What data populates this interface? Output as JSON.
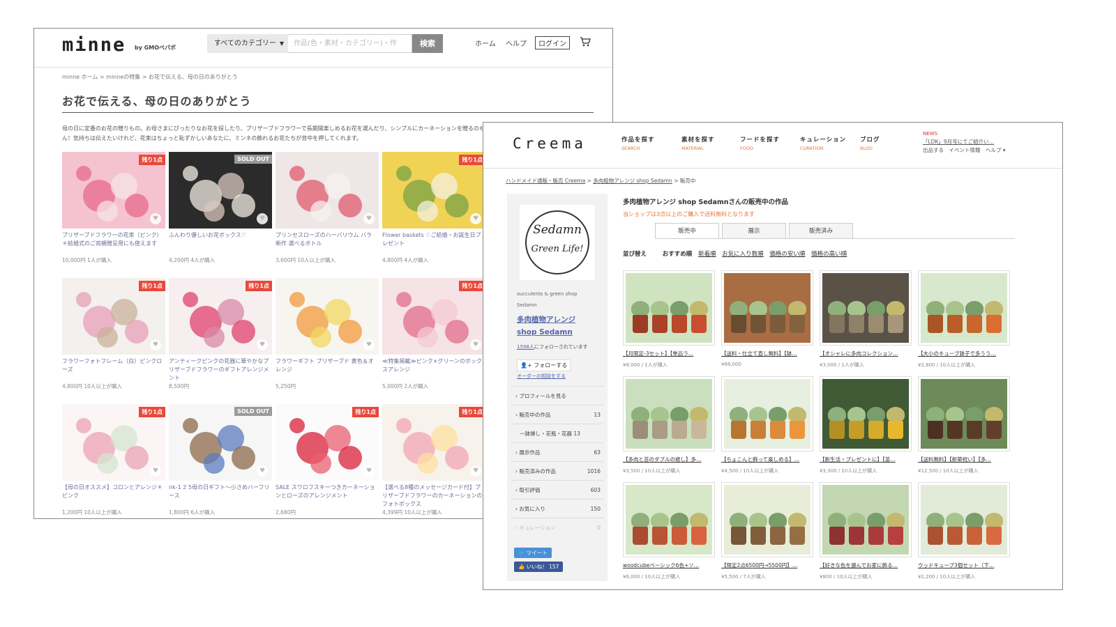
{
  "minne": {
    "logo": "minne",
    "logo_sub": "by GMOペパボ",
    "category_select": "すべてのカテゴリー",
    "search_placeholder": "作品(色・素材・カテゴリー)・作",
    "search_button": "検索",
    "nav_home": "ホーム",
    "nav_help": "ヘルプ",
    "nav_login": "ログイン",
    "breadcrumb": "minne ホーム  >  minneの特集  >  お花で伝える、母の日のありがとう",
    "page_title": "お花で伝える、母の日のありがとう",
    "description": "母の日に定番のお花の贈りもの。お母さまにぴったりなお花を探したり、プリザーブドフラワーで長期間楽しめるお花を選んだり、シンプルにカーネーションを贈るのも素敵ね。今年も人気のハーバリウムもたくさん！気持ちは伝えたいけれど、花束はちょっと恥ずかしいあなたに、ミンネの飾れるお花たちが背中を押してくれます。",
    "products": [
      {
        "badge": "残り1点",
        "name": "プリザーブドフラワーの花束（ピンク）＊結婚式のご両親贈呈用にも使えます",
        "price": "10,000円  1人が購入",
        "colors": [
          "#f4c3cf",
          "#e86a8c",
          "#f7e3e8"
        ]
      },
      {
        "badge": "SOLD OUT",
        "name": "ふんわり優しいお花ボックス♡",
        "price": "4,200円  4人が購入",
        "colors": [
          "#2b2b2b",
          "#f3ece4",
          "#d9c7c0"
        ]
      },
      {
        "badge": "",
        "name": "プリンセスローズのハーバリウム  バラ 新作  選べるボトル",
        "price": "3,600円  10人以上が購入",
        "colors": [
          "#efe6e6",
          "#e05a6e",
          "#f7f0f0"
        ]
      },
      {
        "badge": "残り1点",
        "name": "Flower baskets ♡ご結婚・お誕生日プレゼント",
        "price": "4,800円  4人が購入",
        "colors": [
          "#f0d255",
          "#7aa245",
          "#f5f0e0"
        ]
      },
      {
        "badge": "残り1点",
        "name": "フラワーフォトフレーム（白）ピンクローズ",
        "price": "4,800円  10人以上が購入",
        "colors": [
          "#f3f0ee",
          "#e7a0b8",
          "#c9b29a"
        ]
      },
      {
        "badge": "残り1点",
        "name": "アンティークピンクの花器に華やかなプリザーブドフラワーのギフトアレンジメント",
        "price": "8,500円",
        "colors": [
          "#f7eef0",
          "#e0426e",
          "#d88aa8"
        ]
      },
      {
        "badge": "",
        "name": "フラワーギフト  プリザーブド  黄色＆オレンジ",
        "price": "5,250円",
        "colors": [
          "#f7f5f0",
          "#f19a3e",
          "#f3d860"
        ]
      },
      {
        "badge": "残り1点",
        "name": "≪特集掲載≫ピンク×グリーンのボックスアレンジ",
        "price": "5,000円  2人が購入",
        "colors": [
          "#f5e3e6",
          "#e26d8c",
          "#f6c9d3"
        ]
      },
      {
        "badge": "残り1点",
        "name": "【母の日オススメ】コロンとアレンジ＊ピンク",
        "price": "1,200円  10人以上が購入",
        "colors": [
          "#fcf5f5",
          "#eba3b3",
          "#d6e4d0"
        ]
      },
      {
        "badge": "SOLD OUT",
        "name": "nk-1 2 5母の日ギフト〜小さめハーフリース",
        "price": "1,800円  6人が購入",
        "colors": [
          "#f6f6f6",
          "#8c6a4a",
          "#5b7bbd"
        ]
      },
      {
        "badge": "残り1点",
        "name": "SALE スワロフスキーつきカーネーションとローズのアレンジメント",
        "price": "2,680円",
        "colors": [
          "#fbfbfb",
          "#d9203a",
          "#e86070"
        ]
      },
      {
        "badge": "残り1点",
        "name": "【選べる8種のメッセージカード付】プリザーブドフラワーのカーネーションのフォトボックス",
        "price": "4,399円  10人以上が購入",
        "colors": [
          "#f7f2ec",
          "#f2a5b5",
          "#ffe0a0"
        ]
      }
    ]
  },
  "creema": {
    "logo": "Creema",
    "nav": [
      {
        "jp": "作品を探す",
        "en": "SEARCH"
      },
      {
        "jp": "素材を探す",
        "en": "MATERIAL"
      },
      {
        "jp": "フードを探す",
        "en": "FOOD"
      },
      {
        "jp": "キュレーション",
        "en": "CURATION"
      },
      {
        "jp": "ブログ",
        "en": "BLOG"
      }
    ],
    "news_label": "NEWS",
    "news_text": "「LDK」9月号にてご紹介い…",
    "news_links": "出品する　イベント情報　ヘルプ ▾",
    "breadcrumb_1": "ハンドメイド通販・販売 Creema",
    "breadcrumb_2": "多肉植物アレンジ shop Sedamn",
    "breadcrumb_3": "販売中",
    "shop_logo_1": "Sedamn",
    "shop_logo_2": "Green Life!",
    "shop_sub_1": "succulents & green shop",
    "shop_sub_2": "Sedamn",
    "shop_name_1": "多肉植物アレンジ",
    "shop_name_2": "shop Sedamn",
    "follow_count_num": "1598人",
    "follow_count_text": "にフォローされています",
    "follow_button": "フォローする",
    "order_link": "オーダーの相談をする",
    "menu": [
      {
        "label": "プロフィールを見る",
        "count": ""
      },
      {
        "label": "販売中の作品",
        "count": "13"
      },
      {
        "label": "一鉢挿し・花瓶・花器  13",
        "count": ""
      },
      {
        "label": "展示作品",
        "count": "63"
      },
      {
        "label": "販売済みの作品",
        "count": "1016"
      },
      {
        "label": "取引評価",
        "count": "603"
      },
      {
        "label": "お気に入り",
        "count": "150"
      },
      {
        "label": "キュレーション",
        "count": "0"
      }
    ],
    "tweet": "ツイート",
    "like": "いいね！ 157",
    "main_title": "多肉植物アレンジ shop Sedamnさんの販売中の作品",
    "shipping_note": "当ショップは3点以上のご購入で送料無料となります",
    "tabs": [
      "販売中",
      "展示",
      "販売済み"
    ],
    "sort_label": "並び替え",
    "sort_options": [
      "おすすめ順",
      "新着順",
      "お気に入り数順",
      "価格の安い順",
      "価格の高い順"
    ],
    "products": [
      {
        "name": "【月限定-3セット】【単品ラ…",
        "price": "¥8,000 / 1人が購入",
        "bg": "#cfe3c0",
        "pot": "#b8472a"
      },
      {
        "name": "【送料・仕立て直し無料】【鉢…",
        "price": "¥68,000",
        "bg": "#a86d42",
        "pot": "#7a5a3a"
      },
      {
        "name": "【オシャレに多肉コレクション…",
        "price": "¥3,000 / 1人が購入",
        "bg": "#5a5246",
        "pot": "#9a8a70"
      },
      {
        "name": "【大小のキューブ鉢子で多うう…",
        "price": "¥2,800 / 10人以上が購入",
        "bg": "#d7e8cc",
        "pot": "#c8642c"
      },
      {
        "name": "【多肉と苔のダブルの癒し】多…",
        "price": "¥3,500 / 10人以上が購入",
        "bg": "#c9dfbd",
        "pot": "#b8a890"
      },
      {
        "name": "【ちょこんと飾って楽しめる】…",
        "price": "¥4,500 / 10人以上が購入",
        "bg": "#e6efe0",
        "pot": "#d88a3a"
      },
      {
        "name": "【新生活・プレゼントに】【苗…",
        "price": "¥3,300 / 10人以上が購入",
        "bg": "#3f5a34",
        "pot": "#d4a82a"
      },
      {
        "name": "【送料無料】【新築祝い】【多…",
        "price": "¥12,500 / 10人以上が購入",
        "bg": "#6d8a58",
        "pot": "#5a3a28"
      },
      {
        "name": "woodcubeベーシック6色+ソ…",
        "price": "¥6,000 / 10人以上が購入",
        "bg": "#d6e8c8",
        "pot": "#c85a3a"
      },
      {
        "name": "【限定2点6500円→5500円】…",
        "price": "¥5,500 / 7人が購入",
        "bg": "#e7edd8",
        "pot": "#8a6540"
      },
      {
        "name": "【好きな色を選んでお家に飾る…",
        "price": "¥800 / 10人以上が購入",
        "bg": "#c3d8b2",
        "pot": "#a83a3a"
      },
      {
        "name": "ウッドキューブ3個セット（下…",
        "price": "¥2,200 / 10人以上が購入",
        "bg": "#e2ebd8",
        "pot": "#c8603a"
      }
    ]
  }
}
